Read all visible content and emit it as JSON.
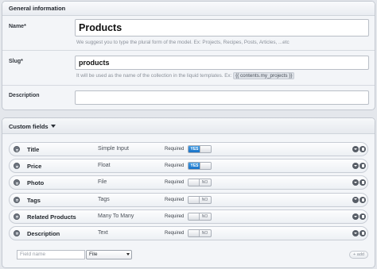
{
  "general": {
    "header": "General information",
    "name_label": "Name*",
    "name_value": "Products",
    "name_hint": "We suggest you to type the plural form of the model. Ex: Projects, Recipes, Posts, Articles, ...etc",
    "slug_label": "Slug*",
    "slug_value": "products",
    "slug_hint": "It will be used as the name of the collection in the liquid templates. Ex:",
    "slug_hint_code": "{{ contents.my_projects }}",
    "description_label": "Description",
    "description_value": ""
  },
  "custom_fields": {
    "header": "Custom fields",
    "required_label": "Required",
    "yes_label": "YES",
    "no_label": "NO",
    "fields": [
      {
        "name": "Title",
        "type": "Simple Input",
        "required": true
      },
      {
        "name": "Price",
        "type": "Float",
        "required": true
      },
      {
        "name": "Photo",
        "type": "File",
        "required": false
      },
      {
        "name": "Tags",
        "type": "Tags",
        "required": false
      },
      {
        "name": "Related Products",
        "type": "Many To Many",
        "required": false
      },
      {
        "name": "Description",
        "type": "Text",
        "required": false
      }
    ],
    "new_field": {
      "placeholder": "Field name",
      "type_selected": "File",
      "add_label": "+ add"
    }
  },
  "colors": {
    "toggle_on": "#1a73c7",
    "background": "#e4e7ec"
  }
}
